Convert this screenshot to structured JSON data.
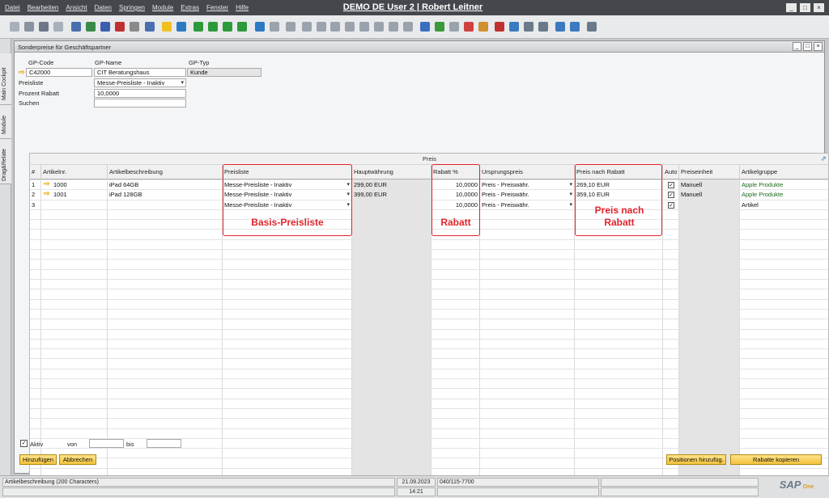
{
  "window": {
    "title": "DEMO DE User 2 | Robert Leitner",
    "menus": [
      "Datei",
      "Bearbeiten",
      "Ansicht",
      "Daten",
      "Springen",
      "Module",
      "Extras",
      "Fenster",
      "Hilfe"
    ],
    "controls": [
      "_",
      "□",
      "×"
    ]
  },
  "toolbar": {
    "icons": [
      "print-preview-icon",
      "print-icon",
      "email-icon",
      "sms-icon",
      "fax-icon",
      "export-excel-icon",
      "export-word-icon",
      "export-pdf-icon",
      "launch-app-icon",
      "lock-screen-icon",
      "find-icon",
      "add-icon",
      "first-record-icon",
      "previous-record-icon",
      "next-record-icon",
      "last-record-icon",
      "filter-icon",
      "sort-icon",
      "base-document-icon",
      "target-document-icon",
      "duplicate-icon",
      "drag-relate-icon",
      "journal-icon",
      "related-document-icon",
      "gross-profit-icon",
      "payment-means-icon",
      "volume-weight-icon",
      "edit-icon",
      "add-row-icon",
      "message-icon",
      "alerts-icon",
      "calendar-icon",
      "crystal-report-icon",
      "report-icon",
      "org-chart-icon",
      "settings-icon",
      "browser-icon",
      "help-icon",
      "calculator-icon"
    ],
    "colors": [
      "#a7b0bb",
      "#8892a0",
      "#6d7787",
      "#a7b0bb",
      "#4a6fae",
      "#3a8a4a",
      "#3a5fb0",
      "#c03030",
      "#8a8a8a",
      "#4a6fae",
      "#f0c020",
      "#2d79c4",
      "#2d9a3a",
      "#2d9a3a",
      "#2d9a3a",
      "#2d9a3a",
      "#2d79c4",
      "#9aa3ad",
      "#9aa3ad",
      "#9aa3ad",
      "#9aa3ad",
      "#9aa3ad",
      "#9aa3ad",
      "#9aa3ad",
      "#9aa3ad",
      "#9aa3ad",
      "#9aa3ad",
      "#3a6fc0",
      "#3a9a3a",
      "#9aa3ad",
      "#d04040",
      "#d09030",
      "#c03030",
      "#3a7ac0",
      "#6a7a8a",
      "#6a7a8a",
      "#3a7ac0",
      "#3a7ac0",
      "#6a7a8a"
    ]
  },
  "side_tabs": [
    "Main Cockpit",
    "Module",
    "Drag&Relate"
  ],
  "form": {
    "title": "Sonderpreise für Geschäftspartner",
    "controls": [
      "_",
      "□",
      "×"
    ],
    "gp_code_label": "GP-Code",
    "gp_code": "C42000",
    "gp_name_label": "GP-Name",
    "gp_name": "CIT Beratungshaus",
    "gp_typ_label": "GP-Typ",
    "gp_typ": "Kunde",
    "preisliste_label": "Preisliste",
    "preisliste": "Messe-Preisliste - Inaktiv",
    "prozent_rabatt_label": "Prozent Rabatt",
    "prozent_rabatt": "10,0000",
    "suchen_label": "Suchen",
    "suchen": ""
  },
  "table": {
    "group_header": "Preis",
    "columns": [
      "#",
      "Artikelnr.",
      "Artikelbeschreibung",
      "Preisliste",
      "Hauptwährung",
      "Rabatt %",
      "Ursprungspreis",
      "Preis nach Rabatt",
      "Auto",
      "Preiseinheit",
      "Artikelgruppe"
    ],
    "rows": [
      {
        "num": "1",
        "item": "1000",
        "desc": "iPad 64GB",
        "pricelist": "Messe-Preisliste - Inaktiv",
        "price": "299,00 EUR",
        "rabatt": "10,0000",
        "origin": "Preis - Preiswähr.",
        "after": "269,10 EUR",
        "auto": true,
        "unit": "Manuell",
        "group": "Apple Produkte"
      },
      {
        "num": "2",
        "item": "1001",
        "desc": "iPad 128GB",
        "pricelist": "Messe-Preisliste - Inaktiv",
        "price": "399,00 EUR",
        "rabatt": "10,0000",
        "origin": "Preis - Preiswähr.",
        "after": "359,10 EUR",
        "auto": true,
        "unit": "Manuell",
        "group": "Apple Produkte"
      },
      {
        "num": "3",
        "item": "",
        "desc": "",
        "pricelist": "Messe-Preisliste - Inaktiv",
        "price": "",
        "rabatt": "10,0000",
        "origin": "Preis - Preiswähr.",
        "after": "",
        "auto": true,
        "unit": "",
        "group": "Artikel"
      }
    ]
  },
  "annotations": {
    "basis": "Basis-Preisliste",
    "rabatt": "Rabatt",
    "preis_nach_rabatt": "Preis nach Rabatt",
    "color": "#e0242b"
  },
  "bottom": {
    "aktiv_label": "Aktiv",
    "von_label": "von",
    "bis_label": "bis",
    "add_button": "Hinzufügen",
    "cancel_button": "Abbrechen",
    "add_positions_button": "Positionen hinzufüg.",
    "copy_discounts_button": "Rabatte kopieren"
  },
  "status": {
    "field_info": "Artikelbeschreibung (200 Characters)",
    "date": "21.09.2023",
    "time": "14:21",
    "phone": "040/115-7700",
    "logo": "SAP Business One"
  }
}
